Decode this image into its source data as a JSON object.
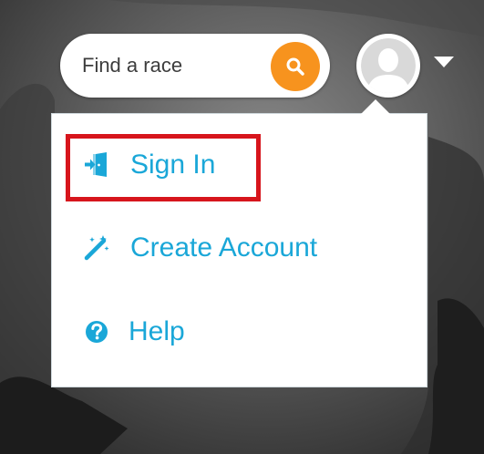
{
  "search": {
    "placeholder": "Find a race"
  },
  "icons": {
    "search": "magnifier-icon",
    "avatar": "user-silhouette-icon",
    "caret": "caret-down-icon",
    "sign_in": "sign-in-door-icon",
    "create_account": "magic-wand-icon",
    "help": "question-circle-icon"
  },
  "menu": {
    "items": [
      {
        "label": "Sign In"
      },
      {
        "label": "Create Account"
      },
      {
        "label": "Help"
      }
    ]
  },
  "colors": {
    "accent": "#1aa7d8",
    "search_button": "#f7931e",
    "highlight": "#d7151c"
  }
}
